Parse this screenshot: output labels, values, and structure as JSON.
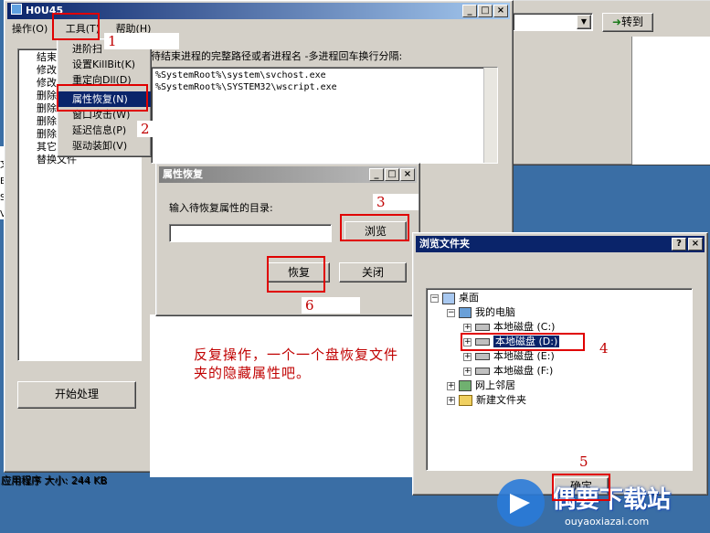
{
  "main_window": {
    "title": "H0U45",
    "menu": [
      "操作(O)",
      "工具(T)",
      "帮助(H)"
    ],
    "left_list": [
      "结束",
      "修改",
      "修改",
      "删除",
      "删除",
      "删除",
      "删除",
      "其它",
      "替换文件"
    ],
    "instructions": "待结束进程的完整路径或者进程名 -多进程回车换行分隔:",
    "process_lines": [
      "%SystemRoot%\\system\\svchost.exe",
      "%SystemRoot%\\SYSTEM32\\wscript.exe"
    ],
    "start_button": "开始处理",
    "status": "应用程序 大小: 244 KB"
  },
  "tools_menu": [
    "进阶扫",
    "设置KillBit(K)",
    "重定向Dll(D)",
    "属性恢复(N)",
    "窗口攻击(W)",
    "延迟信息(P)",
    "驱动装卸(V)"
  ],
  "explorer": {
    "goto_label": "转到",
    "left_fragments": [
      "文",
      "B",
      "S",
      "V"
    ]
  },
  "attr_dialog": {
    "title": "属性恢复",
    "prompt": "输入待恢复属性的目录:",
    "path_value": "",
    "browse_button": "浏览",
    "restore_button": "恢复",
    "close_button": "关闭"
  },
  "browse_dialog": {
    "title": "浏览文件夹",
    "help_btn": "?",
    "tree": {
      "desktop": "桌面",
      "my_computer": "我的电脑",
      "drives": [
        "本地磁盘 (C:)",
        "本地磁盘 (D:)",
        "本地磁盘 (E:)",
        "本地磁盘 (F:)"
      ],
      "network": "网上邻居",
      "new_folder": "新建文件夹"
    },
    "ok_button": "确定"
  },
  "annotation": "反复操作，一个一个盘恢复文件夹的隐藏属性吧。",
  "step_numbers": [
    "1",
    "2",
    "3",
    "4",
    "5",
    "6"
  ],
  "watermark": {
    "brand": "偶要下载站",
    "url": "ouyaoxiazai.com"
  },
  "colors": {
    "desktop": "#3a6ea5",
    "title_active": "#0a246a",
    "highlight": "#c00000"
  }
}
